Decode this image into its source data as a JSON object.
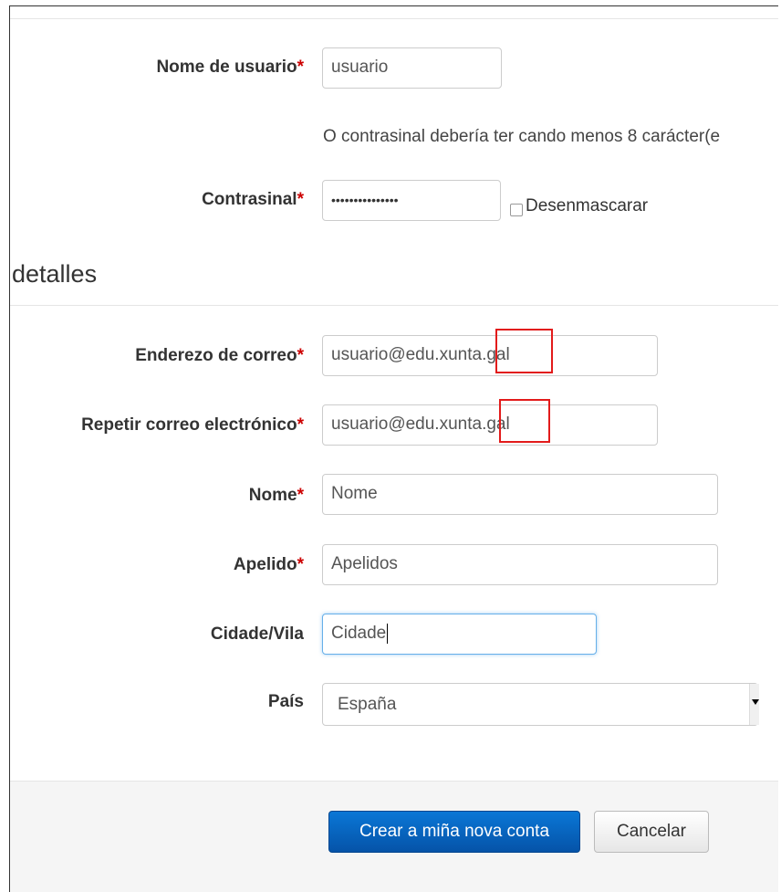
{
  "form": {
    "username": {
      "label": "Nome de usuario",
      "required_mark": "*",
      "value": "usuario"
    },
    "password_hint": "O contrasinal debería ter cando menos 8 carácter(e",
    "password": {
      "label": "Contrasinal",
      "required_mark": "*",
      "value": "•••••••••••••••",
      "unmask_label": "Desenmascarar"
    },
    "section_title": "detalles",
    "email": {
      "label": "Enderezo de correo",
      "required_mark": "*",
      "value": "usuario@edu.xunta.gal"
    },
    "email_repeat": {
      "label": "Repetir correo electrónico",
      "required_mark": "*",
      "value": "usuario@edu.xunta.gal"
    },
    "firstname": {
      "label": "Nome",
      "required_mark": "*",
      "value": "Nome"
    },
    "lastname": {
      "label": "Apelido",
      "required_mark": "*",
      "value": "Apelidos"
    },
    "city": {
      "label": "Cidade/Vila",
      "value": "Cidade"
    },
    "country": {
      "label": "País",
      "selected": "España"
    }
  },
  "actions": {
    "submit_label": "Crear a miña nova conta",
    "cancel_label": "Cancelar"
  },
  "colors": {
    "required": "#cc0000",
    "primary": "#0553a8",
    "highlight_box": "#e21b1b"
  }
}
